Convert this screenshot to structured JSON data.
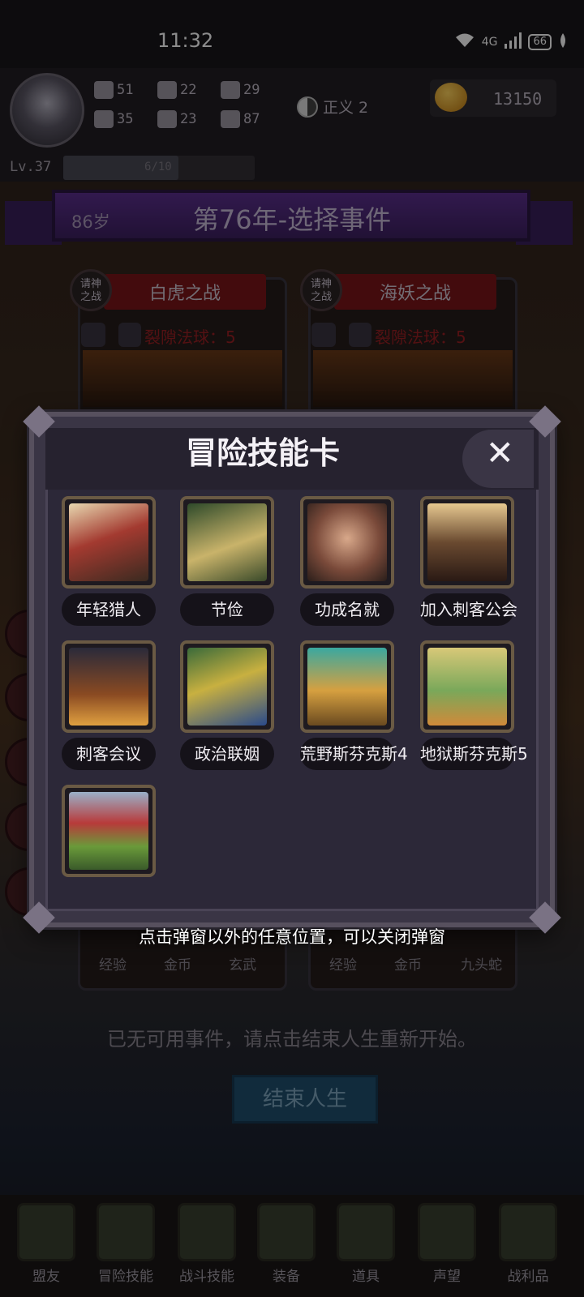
{
  "status_bar": {
    "time": "11:32",
    "network": "4G",
    "battery": "66"
  },
  "profile": {
    "stats": [
      {
        "icon": "fist-icon",
        "value": "51"
      },
      {
        "icon": "quill-icon",
        "value": "22"
      },
      {
        "icon": "wizard-hat-icon",
        "value": "29"
      },
      {
        "icon": "clover-icon",
        "value": "35"
      },
      {
        "icon": "scroll-icon",
        "value": "23"
      },
      {
        "icon": "laurel-icon",
        "value": "87"
      }
    ],
    "alignment": "正义 2",
    "gold": "13150",
    "level": "Lv.37",
    "xp_text": "6/10",
    "xp_progress": 0.6
  },
  "banner": {
    "age": "86岁",
    "title": "第76年-选择事件"
  },
  "events": [
    {
      "badge": "请神\n之战",
      "title": "白虎之战",
      "cost": "裂隙法球：5",
      "rewards": [
        "经验",
        "金币",
        "玄武"
      ]
    },
    {
      "badge": "请神\n之战",
      "title": "海妖之战",
      "cost": "裂隙法球：5",
      "rewards": [
        "经验",
        "金币",
        "九头蛇"
      ]
    }
  ],
  "modal": {
    "title": "冒险技能卡",
    "close_label": "✕",
    "cards": [
      {
        "label": "年轻猎人",
        "art": "hunter"
      },
      {
        "label": "节俭",
        "art": "forest-path"
      },
      {
        "label": "功成名就",
        "art": "portrait"
      },
      {
        "label": "加入刺客公会",
        "art": "assassin"
      },
      {
        "label": "刺客会议",
        "art": "tower"
      },
      {
        "label": "政治联姻",
        "art": "couple"
      },
      {
        "label": "荒野斯芬克斯4",
        "art": "sphinx"
      },
      {
        "label": "地狱斯芬克斯5",
        "art": "pyramid"
      },
      {
        "label": "",
        "art": "tree-landscape"
      }
    ]
  },
  "hint": "点击弹窗以外的任意位置，可以关闭弹窗",
  "no_event_text": "已无可用事件，请点击结束人生重新开始。",
  "end_button": "结束人生",
  "nav": [
    {
      "label": "盟友",
      "icon": "handshake-icon"
    },
    {
      "label": "冒险技能",
      "icon": "book-icon"
    },
    {
      "label": "战斗技能",
      "icon": "backpack-icon"
    },
    {
      "label": "装备",
      "icon": "swords-icon"
    },
    {
      "label": "道具",
      "icon": "satchel-icon"
    },
    {
      "label": "声望",
      "icon": "scroll-icon"
    },
    {
      "label": "战利品",
      "icon": "treasure-chest-icon"
    }
  ],
  "colors": {
    "accent_purple": "#5b2f8e",
    "event_red": "#7a1418",
    "end_button": "#1f4f6e"
  }
}
